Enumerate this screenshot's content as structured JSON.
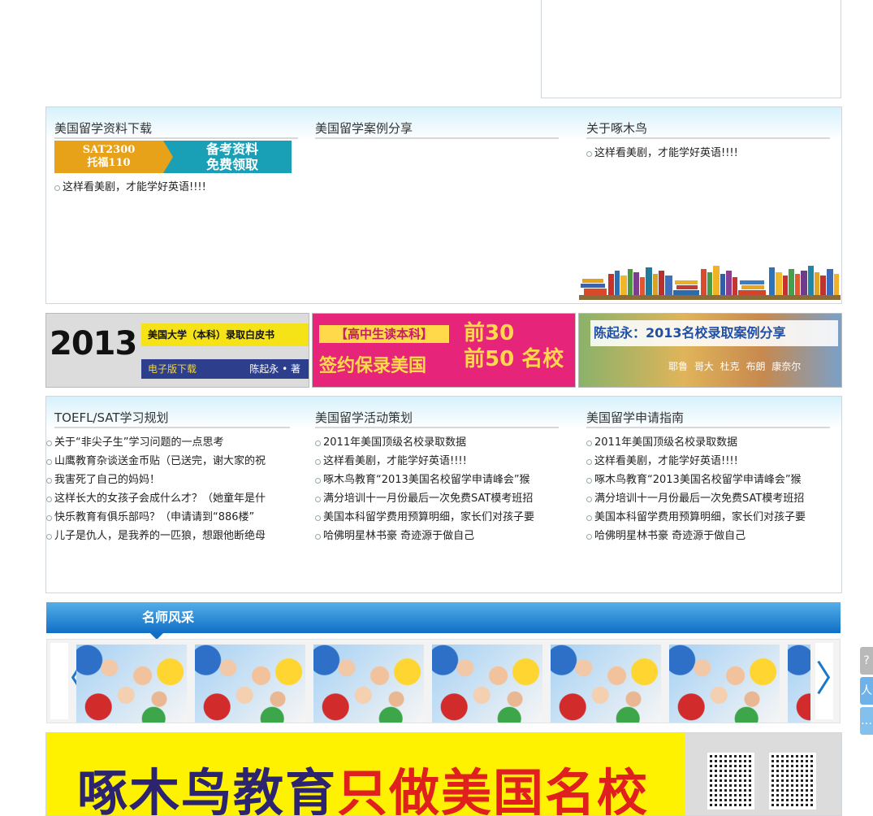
{
  "section1": {
    "col1": {
      "title": "美国留学资料下载",
      "promo": {
        "left_line1": "SAT2300",
        "left_line2": "托福110",
        "right_line1": "备考资料",
        "right_line2": "免费领取"
      },
      "items": [
        "这样看美剧，才能学好英语!!!!"
      ]
    },
    "col2": {
      "title": "美国留学案例分享",
      "items": []
    },
    "col3": {
      "title": "关于啄木鸟",
      "items": [
        "这样看美剧，才能学好英语!!!!"
      ]
    }
  },
  "banners": {
    "b1": {
      "year": "2013",
      "subtitle": "美国大学（本科）录取白皮书",
      "download": "电子版下载",
      "author": "陈起永 • 著"
    },
    "b2": {
      "tag": "【高中生读本科】",
      "main": "签约保录美国",
      "num1": "前30",
      "num2": "前50 名校"
    },
    "b3": {
      "title": "陈起永：2013名校录取案例分享",
      "names": "耶鲁 哥大 杜克 布朗 康奈尔"
    }
  },
  "section2": {
    "col1": {
      "title": "TOEFL/SAT学习规划",
      "items": [
        "关于“非尖子生”学习问题的一点思考",
        "山鹰教育杂谈送金币贴（已送完，谢大家的祝",
        "我害死了自己的妈妈！",
        "这样长大的女孩子会成什么才？（她童年是什",
        "快乐教育有俱乐部吗？（申请请到“886楼”",
        "儿子是仇人，是我养的一匹狼，想跟他断绝母"
      ]
    },
    "col2": {
      "title": "美国留学活动策划",
      "items": [
        "2011年美国顶级名校录取数据",
        "这样看美剧，才能学好英语!!!!",
        "啄木鸟教育“2013美国名校留学申请峰会”猴",
        "满分培训十一月份最后一次免费SAT模考班招",
        "美国本科留学费用预算明细，家长们对孩子要",
        "哈佛明星林书豪 奇迹源于做自己"
      ]
    },
    "col3": {
      "title": "美国留学申请指南",
      "items": [
        "2011年美国顶级名校录取数据",
        "这样看美剧，才能学好英语!!!!",
        "啄木鸟教育“2013美国名校留学申请峰会”猴",
        "满分培训十一月份最后一次免费SAT模考班招",
        "美国本科留学费用预算明细，家长们对孩子要",
        "哈佛明星林书豪 奇迹源于做自己"
      ]
    }
  },
  "teachers": {
    "title": "名师风采",
    "prev": "〈",
    "next": "〉"
  },
  "bottom": {
    "slogan_a": "啄木鸟教育",
    "slogan_b": "只做美国名校"
  },
  "side": {
    "top": "?",
    "user": "人",
    "chat": "…"
  },
  "colors": {
    "accent_blue": "#0f6fc6",
    "panel_top": "#d6f1fb",
    "banner_yellow": "#fff200"
  }
}
